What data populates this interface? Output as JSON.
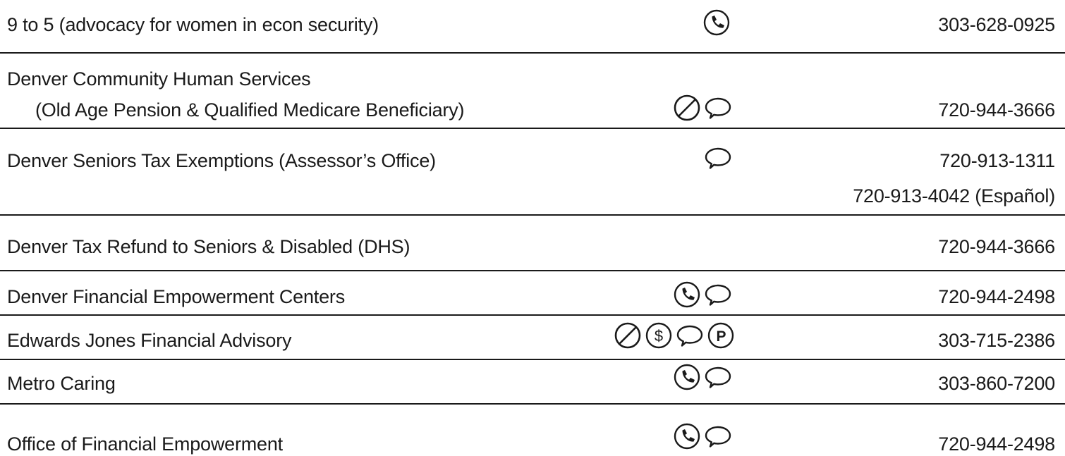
{
  "entries": [
    {
      "name": "9 to 5 (advocacy for women in econ security)",
      "icons": [
        "phone-icon"
      ],
      "phone": "303-628-0925"
    },
    {
      "name": "Denver Community Human Services",
      "subname": "(Old Age Pension & Qualified Medicare Beneficiary)",
      "icons": [
        "no-walk-in-icon",
        "speech-bubble-icon"
      ],
      "phone": "720-944-3666"
    },
    {
      "name": "Denver Seniors Tax Exemptions (Assessor’s Office)",
      "icons": [
        "speech-bubble-icon"
      ],
      "phone": "720-913-1311",
      "phone2": "720-913-4042 (Español)"
    },
    {
      "name": "Denver Tax Refund to Seniors & Disabled (DHS)",
      "icons": [],
      "phone": "720-944-3666"
    },
    {
      "name": "Denver Financial Empowerment Centers",
      "icons": [
        "phone-icon",
        "speech-bubble-icon"
      ],
      "phone": "720-944-2498"
    },
    {
      "name": "Edwards Jones Financial Advisory",
      "icons": [
        "no-walk-in-icon",
        "dollar-icon",
        "speech-bubble-icon",
        "parking-icon"
      ],
      "phone": "303-715-2386"
    },
    {
      "name": "Metro Caring",
      "icons": [
        "phone-icon",
        "speech-bubble-icon"
      ],
      "phone": "303-860-7200"
    },
    {
      "name": "Office of Financial Empowerment",
      "icons": [
        "phone-icon",
        "speech-bubble-icon"
      ],
      "phone": "720-944-2498"
    }
  ],
  "colors": {
    "text": "#1a1a1a",
    "rule": "#1a1a1a",
    "background": "#ffffff"
  }
}
